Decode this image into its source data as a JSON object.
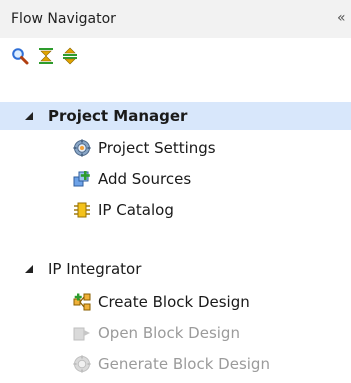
{
  "panel": {
    "title": "Flow Navigator",
    "collapse_glyph": "«"
  },
  "toolbar": {
    "icons": [
      "search-icon",
      "collapse-all-icon",
      "expand-all-icon"
    ]
  },
  "sections": [
    {
      "label": "Project Manager",
      "expanded": true,
      "selected": true,
      "items": [
        {
          "label": "Project Settings",
          "icon": "gear-icon",
          "enabled": true
        },
        {
          "label": "Add Sources",
          "icon": "add-sources-icon",
          "enabled": true
        },
        {
          "label": "IP Catalog",
          "icon": "chip-icon",
          "enabled": true
        }
      ]
    },
    {
      "label": "IP Integrator",
      "expanded": true,
      "selected": false,
      "items": [
        {
          "label": "Create Block Design",
          "icon": "block-design-icon",
          "enabled": true
        },
        {
          "label": "Open Block Design",
          "icon": "open-block-design-icon",
          "enabled": false
        },
        {
          "label": "Generate Block Design",
          "icon": "gear-icon",
          "enabled": false
        }
      ]
    }
  ],
  "colors": {
    "selected_row": "#d8e7fb",
    "header_bg": "#f2f2f2",
    "disabled_text": "#9b9b9b"
  }
}
